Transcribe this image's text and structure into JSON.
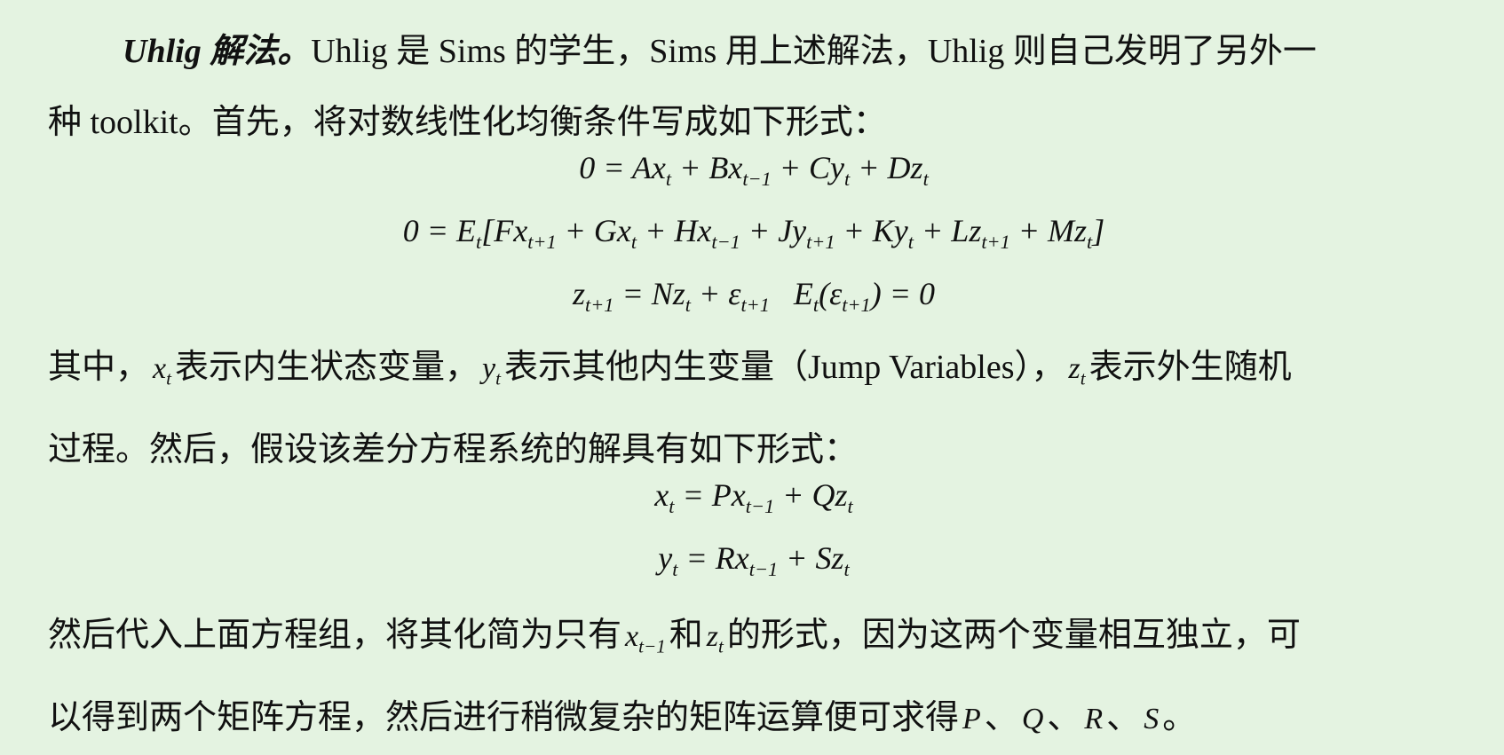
{
  "para1": {
    "lead": "Uhlig 解法。",
    "text_line1": "Uhlig 是 Sims 的学生，Sims 用上述解法，Uhlig 则自己发明了另外一",
    "text_line2": "种 toolkit。首先，将对数线性化均衡条件写成如下形式："
  },
  "equations1": [
    "0 = Ax_t + Bx_{t−1} + Cy_t + Dz_t",
    "0 = E_t[Fx_{t+1} + Gx_t + Hx_{t−1} + Jy_{t+1} + Ky_t + Lz_{t+1} + Mz_t]",
    "z_{t+1} = Nz_t + ε_{t+1}   E_t(ε_{t+1}) = 0"
  ],
  "para2": {
    "line1_a": "其中，",
    "var_x": "x",
    "line1_b": "表示内生状态变量，",
    "var_y": "y",
    "line1_c": "表示其他内生变量（Jump Variables），",
    "var_z": "z",
    "line1_d": "表示外生随机",
    "line2": "过程。然后，假设该差分方程系统的解具有如下形式："
  },
  "equations2": [
    "x_t = Px_{t−1} + Qz_t",
    "y_t = Rx_{t−1} + Sz_t"
  ],
  "para3": {
    "line1_a": "然后代入上面方程组，将其化简为只有",
    "var_x": "x",
    "sub_x": "t−1",
    "line1_b": "和",
    "var_z": "z",
    "sub_z": "t",
    "line1_c": "的形式，因为这两个变量相互独立，可",
    "line2_a": "以得到两个矩阵方程，然后进行稍微复杂的矩阵运算便可求得",
    "P": "P",
    "Q": "Q",
    "R": "R",
    "S": "S",
    "sep": "、",
    "end": "。"
  },
  "subs": {
    "t": "t",
    "t_minus_1": "t−1",
    "t_plus_1": "t+1"
  }
}
